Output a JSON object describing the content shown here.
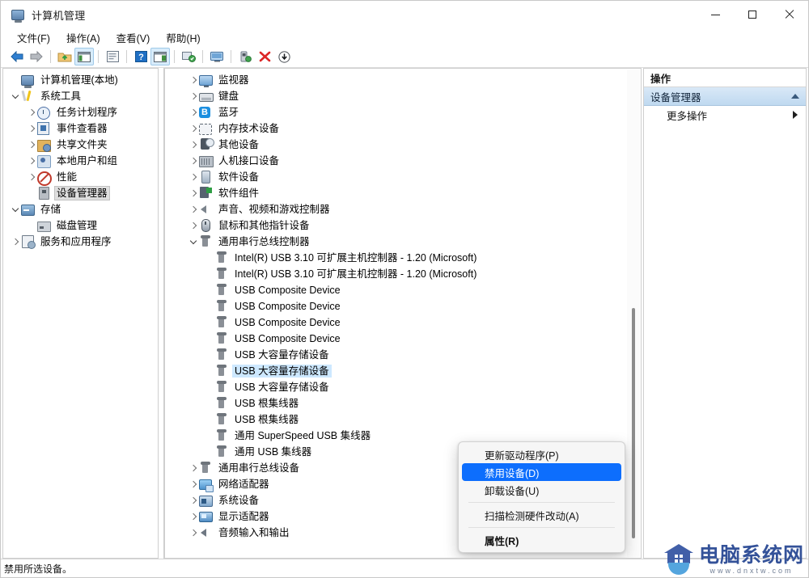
{
  "window": {
    "title": "计算机管理",
    "icon": "computer-management-icon",
    "minimize": "—",
    "maximize": "□",
    "close": "✕"
  },
  "menubar": [
    {
      "label": "文件(F)",
      "name": "menu-file"
    },
    {
      "label": "操作(A)",
      "name": "menu-action"
    },
    {
      "label": "查看(V)",
      "name": "menu-view"
    },
    {
      "label": "帮助(H)",
      "name": "menu-help"
    }
  ],
  "toolbar": [
    {
      "name": "back-icon"
    },
    {
      "name": "forward-icon"
    },
    {
      "name": "up-folder-icon"
    },
    {
      "name": "show-console-tree-icon"
    },
    {
      "name": "properties-icon"
    },
    {
      "name": "help-icon"
    },
    {
      "name": "show-action-pane-icon"
    },
    {
      "name": "scan-hardware-changes-icon"
    },
    {
      "name": "update-driver-icon"
    },
    {
      "name": "disable-device-icon"
    },
    {
      "name": "uninstall-device-icon"
    },
    {
      "name": "download-icon"
    }
  ],
  "sidebar": {
    "items": [
      {
        "label": "计算机管理(本地)",
        "icon": "computer-icon",
        "indent": 0,
        "chev": "none",
        "selected": false
      },
      {
        "label": "系统工具",
        "icon": "tools-icon",
        "indent": 0,
        "chev": "down",
        "selected": false
      },
      {
        "label": "任务计划程序",
        "icon": "clock-icon",
        "indent": 1,
        "chev": "right",
        "selected": false
      },
      {
        "label": "事件查看器",
        "icon": "event-icon",
        "indent": 1,
        "chev": "right",
        "selected": false
      },
      {
        "label": "共享文件夹",
        "icon": "shared-folder-icon",
        "indent": 1,
        "chev": "right",
        "selected": false
      },
      {
        "label": "本地用户和组",
        "icon": "users-icon",
        "indent": 1,
        "chev": "right",
        "selected": false
      },
      {
        "label": "性能",
        "icon": "performance-icon",
        "indent": 1,
        "chev": "right",
        "selected": false
      },
      {
        "label": "设备管理器",
        "icon": "device-manager-icon",
        "indent": 1,
        "chev": "none",
        "selected": true
      },
      {
        "label": "存储",
        "icon": "storage-icon",
        "indent": 0,
        "chev": "down",
        "selected": false
      },
      {
        "label": "磁盘管理",
        "icon": "disk-icon",
        "indent": 1,
        "chev": "none",
        "selected": false
      },
      {
        "label": "服务和应用程序",
        "icon": "services-icon",
        "indent": 0,
        "chev": "right",
        "selected": false
      }
    ]
  },
  "devicetree": {
    "items": [
      {
        "label": "监视器",
        "icon": "monitor-icon",
        "indent": 1,
        "chev": "right",
        "selected": false
      },
      {
        "label": "键盘",
        "icon": "keyboard-icon",
        "indent": 1,
        "chev": "right",
        "selected": false
      },
      {
        "label": "蓝牙",
        "icon": "bluetooth-icon",
        "indent": 1,
        "chev": "right",
        "selected": false
      },
      {
        "label": "内存技术设备",
        "icon": "memory-icon",
        "indent": 1,
        "chev": "right",
        "selected": false
      },
      {
        "label": "其他设备",
        "icon": "other-device-icon",
        "indent": 1,
        "chev": "right",
        "selected": false
      },
      {
        "label": "人机接口设备",
        "icon": "hid-icon",
        "indent": 1,
        "chev": "right",
        "selected": false
      },
      {
        "label": "软件设备",
        "icon": "software-device-icon",
        "indent": 1,
        "chev": "right",
        "selected": false
      },
      {
        "label": "软件组件",
        "icon": "software-component-icon",
        "indent": 1,
        "chev": "right",
        "selected": false
      },
      {
        "label": "声音、视频和游戏控制器",
        "icon": "sound-icon",
        "indent": 1,
        "chev": "right",
        "selected": false
      },
      {
        "label": "鼠标和其他指针设备",
        "icon": "mouse-icon",
        "indent": 1,
        "chev": "right",
        "selected": false
      },
      {
        "label": "通用串行总线控制器",
        "icon": "usb-icon",
        "indent": 1,
        "chev": "down",
        "selected": false
      },
      {
        "label": "Intel(R) USB 3.10 可扩展主机控制器 - 1.20 (Microsoft)",
        "icon": "usb-icon",
        "indent": 2,
        "chev": "none",
        "selected": false
      },
      {
        "label": "Intel(R) USB 3.10 可扩展主机控制器 - 1.20 (Microsoft)",
        "icon": "usb-icon",
        "indent": 2,
        "chev": "none",
        "selected": false
      },
      {
        "label": "USB Composite Device",
        "icon": "usb-icon",
        "indent": 2,
        "chev": "none",
        "selected": false
      },
      {
        "label": "USB Composite Device",
        "icon": "usb-icon",
        "indent": 2,
        "chev": "none",
        "selected": false
      },
      {
        "label": "USB Composite Device",
        "icon": "usb-icon",
        "indent": 2,
        "chev": "none",
        "selected": false
      },
      {
        "label": "USB Composite Device",
        "icon": "usb-icon",
        "indent": 2,
        "chev": "none",
        "selected": false
      },
      {
        "label": "USB 大容量存储设备",
        "icon": "usb-icon",
        "indent": 2,
        "chev": "none",
        "selected": false
      },
      {
        "label": "USB 大容量存储设备",
        "icon": "usb-icon",
        "indent": 2,
        "chev": "none",
        "selected": true
      },
      {
        "label": "USB 大容量存储设备",
        "icon": "usb-icon",
        "indent": 2,
        "chev": "none",
        "selected": false
      },
      {
        "label": "USB 根集线器",
        "icon": "usb-icon",
        "indent": 2,
        "chev": "none",
        "selected": false
      },
      {
        "label": "USB 根集线器",
        "icon": "usb-icon",
        "indent": 2,
        "chev": "none",
        "selected": false
      },
      {
        "label": "通用 SuperSpeed USB 集线器",
        "icon": "usb-icon",
        "indent": 2,
        "chev": "none",
        "selected": false
      },
      {
        "label": "通用 USB 集线器",
        "icon": "usb-icon",
        "indent": 2,
        "chev": "none",
        "selected": false
      },
      {
        "label": "通用串行总线设备",
        "icon": "usb-icon",
        "indent": 1,
        "chev": "right",
        "selected": false
      },
      {
        "label": "网络适配器",
        "icon": "network-icon",
        "indent": 1,
        "chev": "right",
        "selected": false
      },
      {
        "label": "系统设备",
        "icon": "system-device-icon",
        "indent": 1,
        "chev": "right",
        "selected": false
      },
      {
        "label": "显示适配器",
        "icon": "display-icon",
        "indent": 1,
        "chev": "right",
        "selected": false
      },
      {
        "label": "音频输入和输出",
        "icon": "audio-icon",
        "indent": 1,
        "chev": "right",
        "selected": false
      }
    ]
  },
  "contextmenu": {
    "items": [
      {
        "label": "更新驱动程序(P)",
        "name": "ctx-update-driver",
        "highlight": false,
        "bold": false,
        "sep_after": false
      },
      {
        "label": "禁用设备(D)",
        "name": "ctx-disable-device",
        "highlight": true,
        "bold": false,
        "sep_after": false
      },
      {
        "label": "卸载设备(U)",
        "name": "ctx-uninstall-device",
        "highlight": false,
        "bold": false,
        "sep_after": true
      },
      {
        "label": "扫描检测硬件改动(A)",
        "name": "ctx-scan-hardware",
        "highlight": false,
        "bold": false,
        "sep_after": true
      },
      {
        "label": "属性(R)",
        "name": "ctx-properties",
        "highlight": false,
        "bold": true,
        "sep_after": false
      }
    ]
  },
  "actionpane": {
    "header": "操作",
    "group": "设备管理器",
    "items": [
      {
        "label": "更多操作",
        "name": "action-more-actions"
      }
    ]
  },
  "statusbar": {
    "text": "禁用所选设备。"
  },
  "watermark": {
    "name": "电脑系统网",
    "url": "www.dnxtw.com"
  },
  "colors": {
    "selection_blue": "#cde8ff",
    "menu_highlight": "#0d6efd",
    "action_group_bg": "#bfd9f0",
    "watermark_blue": "#2e4d96"
  }
}
